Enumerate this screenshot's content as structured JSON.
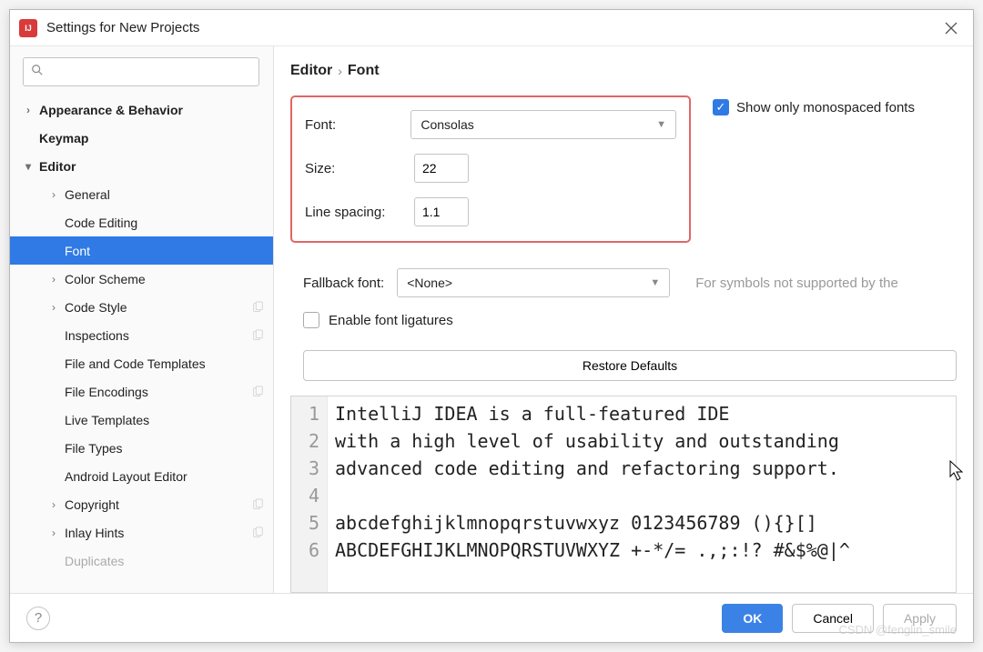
{
  "window": {
    "title": "Settings for New Projects"
  },
  "sidebar": {
    "search_placeholder": "",
    "items": [
      {
        "label": "Appearance & Behavior",
        "level": 0,
        "chev": "right"
      },
      {
        "label": "Keymap",
        "level": 0
      },
      {
        "label": "Editor",
        "level": 0,
        "chev": "down"
      },
      {
        "label": "General",
        "level": 1,
        "chev": "right"
      },
      {
        "label": "Code Editing",
        "level": 1
      },
      {
        "label": "Font",
        "level": 1,
        "selected": true
      },
      {
        "label": "Color Scheme",
        "level": 1,
        "chev": "right"
      },
      {
        "label": "Code Style",
        "level": 1,
        "chev": "right",
        "copy": true
      },
      {
        "label": "Inspections",
        "level": 1,
        "copy": true
      },
      {
        "label": "File and Code Templates",
        "level": 1
      },
      {
        "label": "File Encodings",
        "level": 1,
        "copy": true
      },
      {
        "label": "Live Templates",
        "level": 1
      },
      {
        "label": "File Types",
        "level": 1
      },
      {
        "label": "Android Layout Editor",
        "level": 1
      },
      {
        "label": "Copyright",
        "level": 1,
        "chev": "right",
        "copy": true
      },
      {
        "label": "Inlay Hints",
        "level": 1,
        "chev": "right",
        "copy": true
      },
      {
        "label": "Duplicates",
        "level": 1,
        "truncated": true
      }
    ]
  },
  "breadcrumb": {
    "parent": "Editor",
    "current": "Font"
  },
  "form": {
    "font_label": "Font:",
    "font_value": "Consolas",
    "size_label": "Size:",
    "size_value": "22",
    "line_spacing_label": "Line spacing:",
    "line_spacing_value": "1.1",
    "mono_label": "Show only monospaced fonts",
    "mono_checked": true,
    "fallback_label": "Fallback font:",
    "fallback_value": "<None>",
    "fallback_hint": "For symbols not supported by the",
    "ligatures_label": "Enable font ligatures",
    "restore_label": "Restore Defaults"
  },
  "preview": {
    "lines": [
      "IntelliJ IDEA is a full-featured IDE",
      "with a high level of usability and outstanding",
      "advanced code editing and refactoring support.",
      "",
      "abcdefghijklmnopqrstuvwxyz 0123456789 (){}[]",
      "ABCDEFGHIJKLMNOPQRSTUVWXYZ +-*/= .,;:!? #&$%@|^"
    ]
  },
  "footer": {
    "ok": "OK",
    "cancel": "Cancel",
    "apply": "Apply"
  },
  "watermark": "CSDN @fenglin_smile"
}
